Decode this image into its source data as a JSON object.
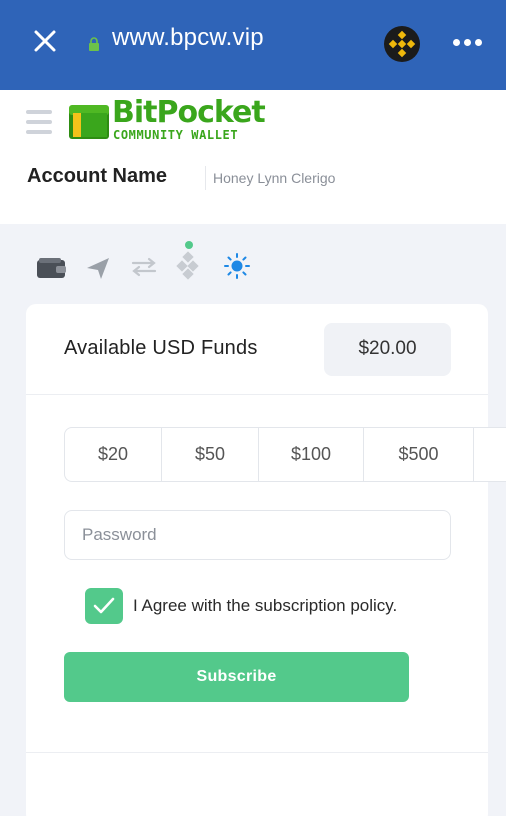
{
  "browser": {
    "url": "www.bpcw.vip",
    "close_icon": "close-icon",
    "lock_icon": "lock-icon",
    "extension_icon": "binance-icon",
    "more_icon": "more-icon"
  },
  "header": {
    "menu_icon": "hamburger-icon",
    "logo_title": "BitPocket",
    "logo_subtitle": "COMMUNITY WALLET"
  },
  "account": {
    "label": "Account Name",
    "value": "Honey Lynn Clerigo"
  },
  "tabs": [
    {
      "icon": "wallet-icon"
    },
    {
      "icon": "send-icon"
    },
    {
      "icon": "transfer-icon"
    },
    {
      "icon": "stake-icon"
    },
    {
      "icon": "sun-icon"
    }
  ],
  "funds": {
    "label": "Available USD Funds",
    "value": "$20.00"
  },
  "amounts": [
    "$20",
    "$50",
    "$100",
    "$500"
  ],
  "form": {
    "password_placeholder": "Password",
    "agree_label": "I Agree with the subscription policy.",
    "agree_checked": true,
    "subscribe_label": "Subscribe"
  },
  "colors": {
    "browser_bar": "#2f64b8",
    "accent_green": "#53c98b",
    "logo_green": "#3aa61c",
    "active_tab": "#1e88e5"
  }
}
